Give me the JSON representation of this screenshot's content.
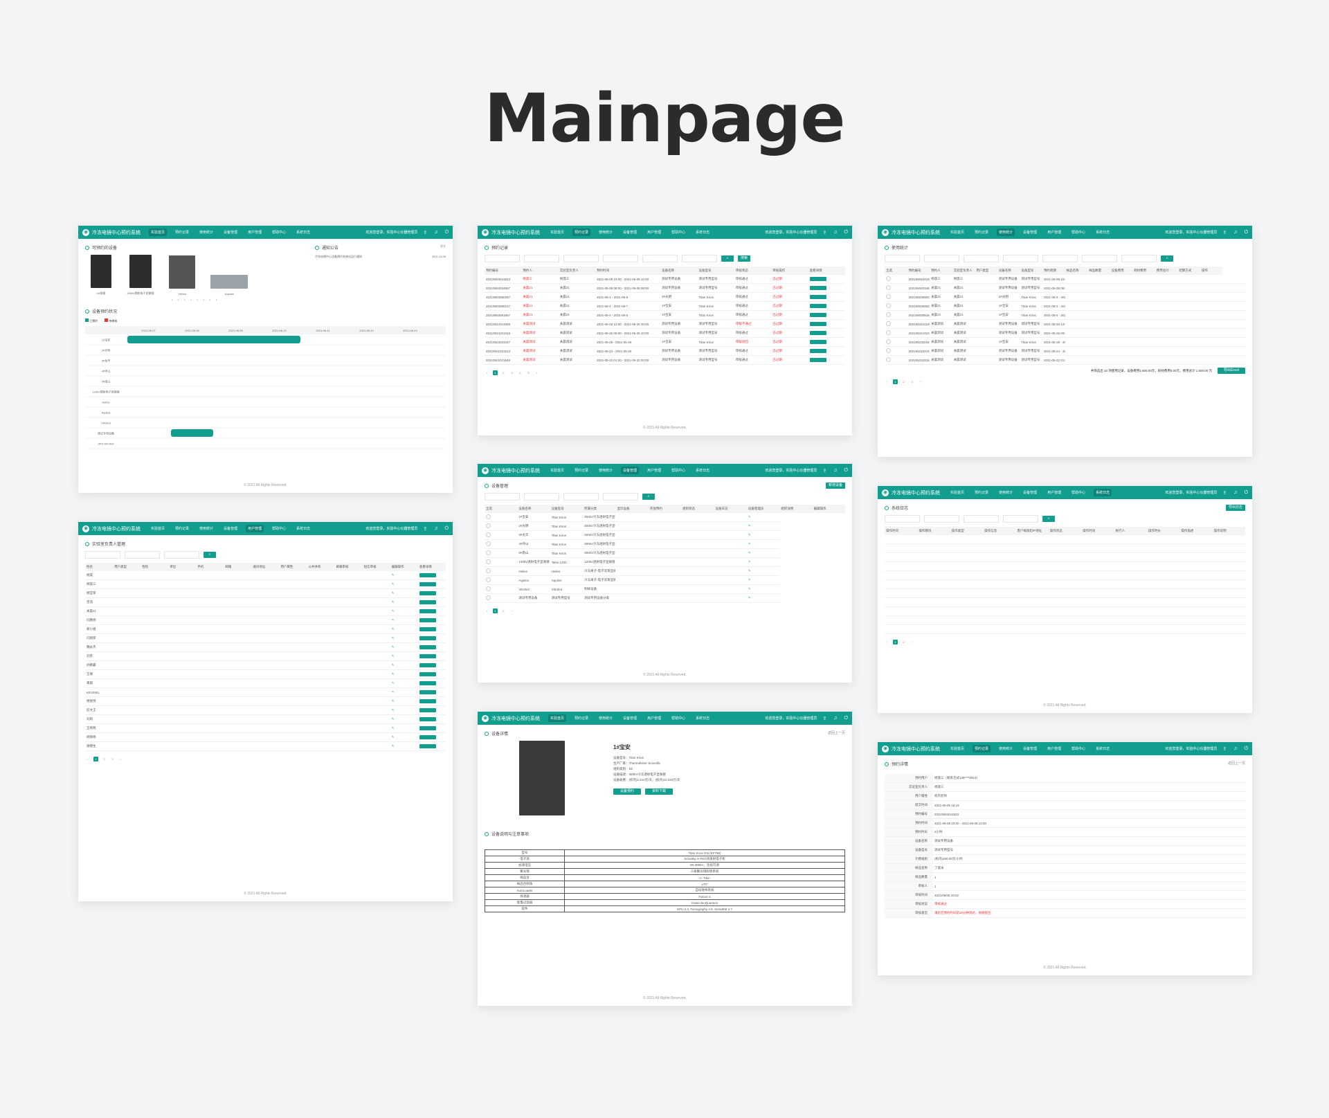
{
  "heading": "Mainpage",
  "colors": {
    "primary": "#119e8f",
    "danger": "#e53935"
  },
  "topbar": {
    "system_name": "冷冻电镜中心预约系统",
    "nav": [
      "实验首页",
      "预约记录",
      "使用统计",
      "设备管理",
      "用户管理",
      "帮助中心",
      "系统日志"
    ],
    "welcome": "欢迎您登录，实验中心仪器管理员",
    "icons": [
      "upload-icon",
      "bell-icon",
      "power-icon"
    ]
  },
  "footer": "© 2021 All Rights Reserved.",
  "card1": {
    "sec_devices": "可预约的设备",
    "sec_notice": "通知公告",
    "notice_more": "更多",
    "notice_item": "冷冻电镜中心设备预约系统试运行通知",
    "notice_date": "2021-11-09",
    "device_names": [
      "1#电镜",
      "120kV透射电子显微镜",
      "Helios",
      "Aquilos"
    ],
    "sec_schedule": "设备预约状况",
    "legend": [
      "已预约",
      "待审核"
    ],
    "schedule_cols": [
      "2021-06-07",
      "2021-06-08",
      "2021-06-09",
      "2021-06-10",
      "2021-06-11",
      "2021-06-12",
      "2021-06-13"
    ],
    "schedule_rows": [
      "1#宝安",
      "2#光明",
      "3#龙华",
      "4#坪山",
      "5#南山",
      "120kV透射电子显微镜",
      "Helios",
      "Aquilos",
      "Vitrobot",
      "测试专用设备",
      "ZPH-Vitrobot"
    ]
  },
  "card2": {
    "title": "预约记录",
    "search": "搜索",
    "cols": [
      "预约编号",
      "预约人",
      "实验室负责人",
      "预约时间",
      "设备名称",
      "设备型号",
      "审核状态",
      "审核操作",
      "查看详情"
    ],
    "rows": [
      [
        "20210604041923",
        "杨晟三",
        "杨晟三",
        "2021-06-08 10:00 - 2021-06-08 12:00",
        "测试专用设备",
        "测试专用型号",
        "审核通过",
        "已过期"
      ],
      [
        "20210604034657",
        "关晨21",
        "关晨21",
        "2021-06-08 08:00 - 2021-06-08 09:00",
        "测试专用设备",
        "测试专用型号",
        "审核通过",
        "已过期"
      ],
      [
        "20210603090257",
        "关晨21",
        "关晨21",
        "2021-06-4 - 2021-06-5",
        "2#光明",
        "Titan Krios",
        "审核通过",
        "已过期"
      ],
      [
        "20210603090217",
        "关晨21",
        "关晨21",
        "2021-06-4 - 2021-06-7",
        "1#宝安",
        "Titan Krios",
        "审核通过",
        "已过期"
      ],
      [
        "20210603081657",
        "关晨21",
        "关晨21",
        "2021-06-4 - 2021-06-5",
        "1#宝安",
        "Titan Krios",
        "审核通过",
        "已过期"
      ],
      [
        "20210524101909",
        "关晨测试",
        "关晨测试",
        "2021-05-26 14:00 - 2021-05-26 20:00",
        "测试专用设备",
        "测试专用型号",
        "审核不通过",
        "已过期"
      ],
      [
        "20210524101015",
        "关晨测试",
        "关晨测试",
        "2021-05-26 00:00 - 2021-05-26 10:00",
        "测试专用设备",
        "测试专用型号",
        "审核通过",
        "已过期"
      ],
      [
        "20210523023437",
        "关晨测试",
        "关晨测试",
        "2021-05-28 - 2021-05-28",
        "1#宝安",
        "Titan Krios",
        "审核驳回",
        "已过期"
      ],
      [
        "20210521021513",
        "关晨测试",
        "关晨测试",
        "2021-05-24 - 2021-05-25",
        "测试专用设备",
        "测试专用型号",
        "审核通过",
        "已过期"
      ],
      [
        "20210521021649",
        "关晨测试",
        "关晨测试",
        "2021-05-22 01:00 - 2021-05-22 03:00",
        "测试专用设备",
        "测试专用型号",
        "审核通过",
        "已过期"
      ]
    ]
  },
  "card3": {
    "title": "使用统计",
    "summary": "共筛选出 10 项使用记录，设备费用1,500.00元，耗材费用0.00元，费用总计 1,500.00 元",
    "export": "导出Excel",
    "cols": [
      "全选",
      "预约编号",
      "预约人",
      "实验室负责人",
      "用户类型",
      "设备名称",
      "设备型号",
      "预约周期",
      "样品名称",
      "样品数量",
      "设备费用",
      "耗材费用",
      "费用总计",
      "结算方式",
      "操作"
    ]
  },
  "card4": {
    "title": "设备管理",
    "add": "新增设备",
    "cols": [
      "全选",
      "设备名称",
      "设备型号",
      "所属分类",
      "显示设备",
      "开放预约",
      "组织状态",
      "设备日志",
      "设备管理员",
      "组织详情",
      "编辑操作"
    ],
    "devices": [
      [
        "1#宝安",
        "Titan Krios",
        "300kV冷冻透射电子显微镜"
      ],
      [
        "2#光明",
        "Titan Krios",
        "300kV冷冻透射电子显微镜"
      ],
      [
        "3#龙华",
        "Titan Krios",
        "300kV冷冻透射电子显微镜"
      ],
      [
        "4#坪山",
        "Titan Krios",
        "300kV冷冻透射电子显微镜"
      ],
      [
        "5#南山",
        "Titan Krios",
        "300kV冷冻透射电子显微镜"
      ],
      [
        "120kV透射电子显微镜",
        "Talos 120C",
        "120kV透射电子显微镜"
      ],
      [
        "Helios",
        "Helios",
        "冷冻离子-电子双束显微镜"
      ],
      [
        "Aquilos",
        "Aquilos",
        "冷冻离子-电子双束显微镜"
      ],
      [
        "Vitrobot",
        "Vitrobot",
        "制样设备"
      ],
      [
        "测试专用设备",
        "测试专用型号",
        "测试专用设备分类"
      ]
    ]
  },
  "card5": {
    "title": "实验室负责人管理",
    "cols": [
      "姓名",
      "用户类型",
      "性别",
      "单位",
      "手机",
      "邮箱",
      "通讯地址",
      "用户属性",
      "公共体系",
      "邮箱审核",
      "短信审核",
      "编辑操作",
      "查看详情"
    ],
    "names": [
      "杨晟",
      "杨晟三",
      "杨宜厚",
      "曾浩",
      "关晨21",
      "闫鹏杨",
      "郑小姐",
      "闫刚厚",
      "魏永杰",
      "刘宗",
      "孙鹏霸",
      "王璐",
      "黄辅",
      "KEVINKL",
      "杨悦悦",
      "彭文王",
      "刘莉",
      "王晓晓",
      "闵晓杨",
      "谢锦生"
    ]
  },
  "card6": {
    "title": "系统日志",
    "export": "导出日志",
    "cols": [
      "操作时间",
      "操作模块",
      "操作类型",
      "操作信息",
      "客户端发起IP地址",
      "操作状态",
      "操作时间",
      "执行人",
      "操作时长",
      "操作描述",
      "操作说明"
    ]
  },
  "card7": {
    "title": "设备详情",
    "back": "返回上一页",
    "device_name": "1#宝安",
    "info": [
      "设备型号：Titan Krios",
      "生产厂家：Thermofisher Scientific",
      "组织类别：1D",
      "设备描述：300kV冷冻透射电子显微镜",
      "设备收费：(校内)1,610元/天，(校外)10,220元/天"
    ],
    "btn_reserve": "设备预约",
    "btn_download": "资料下载",
    "section": "设备说明与注意事项",
    "spec_rows": [
      [
        "型号",
        "Titan Krios G3i (EF796)"
      ],
      [
        "电子源",
        "Schottky-X-FEG场发射电子枪"
      ],
      [
        "加速电压",
        "80-300kV，连续可调"
      ],
      [
        "聚光镜",
        "三级聚光镜照明系统"
      ],
      [
        "样品台",
        "C- Twin"
      ],
      [
        "样品台倾角",
        "±70°"
      ],
      [
        "AutoLoader",
        "自动进样系统"
      ],
      [
        "探测器",
        "Falcon 4"
      ],
      [
        "能量过滤器",
        "Gatan BioQuantum"
      ],
      [
        "软件",
        "EPU 2.3, Tomography 4.8, SerialEM 3.7"
      ]
    ]
  },
  "card8": {
    "title": "预约详情",
    "back": "返回上一页",
    "rows": [
      [
        "预约用户",
        "杨晟三（联系方式138****0913）"
      ],
      [
        "实验室负责人",
        "杨晟三"
      ],
      [
        "用户属性",
        "校内老师"
      ],
      [
        "提交时间",
        "2021-06-06 16:19"
      ],
      [
        "预约编号",
        "20210604041923"
      ],
      [
        "预约时间",
        "2021-06-08 10:00 - 2021-06-08 12:00"
      ],
      [
        "预约时长",
        "2小时"
      ],
      [
        "设备名称",
        "测试专用设备"
      ],
      [
        "设备型号",
        "测试专用型号"
      ],
      [
        "计费规则",
        "(校内)200.00元/小时"
      ],
      [
        "样品名称",
        "了蛋米"
      ],
      [
        "样品数量",
        "1"
      ],
      [
        "审核人",
        "1"
      ],
      [
        "审核时间",
        "2021/06/06 20:02"
      ],
      [
        "审核状态",
        "审核通过"
      ],
      [
        "审核意见",
        "请您在预约时间前30分钟到达，谢谢配合"
      ]
    ]
  }
}
